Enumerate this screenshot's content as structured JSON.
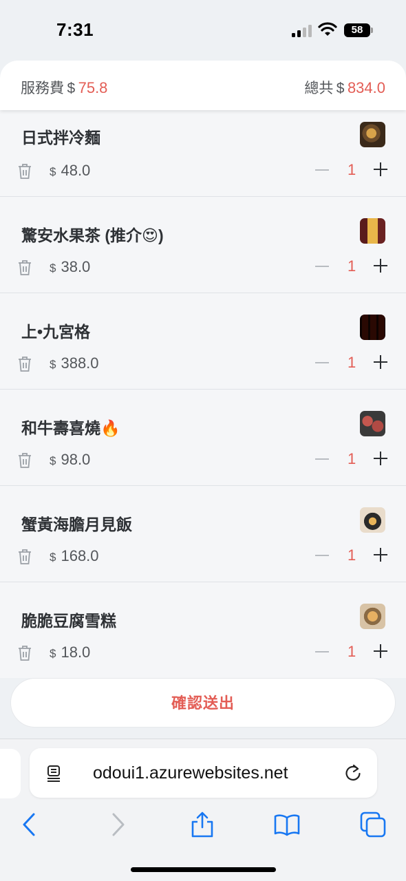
{
  "status_bar": {
    "time": "7:31",
    "battery": "58"
  },
  "summary": {
    "service_label": "服務費",
    "service_currency": "$",
    "service_value": "75.8",
    "total_label": "總共",
    "total_currency": "$",
    "total_value": "834.0"
  },
  "currency": "$",
  "items": [
    {
      "name": "日式拌冷麵",
      "price": "48.0",
      "qty": "1",
      "thumb_icon": "noodle-dish-thumbnail"
    },
    {
      "name": "驚安水果茶 (推介😍)",
      "price": "38.0",
      "qty": "1",
      "thumb_icon": "fruit-tea-thumbnail"
    },
    {
      "name": "上•九宮格",
      "price": "388.0",
      "qty": "1",
      "thumb_icon": "bento-box-thumbnail"
    },
    {
      "name": "和牛壽喜燒🔥",
      "price": "98.0",
      "qty": "1",
      "thumb_icon": "wagyu-thumbnail"
    },
    {
      "name": "蟹黃海膽月見飯",
      "price": "168.0",
      "qty": "1",
      "thumb_icon": "rice-bowl-thumbnail"
    },
    {
      "name": "脆脆豆腐雪糕",
      "price": "18.0",
      "qty": "1",
      "thumb_icon": "tofu-icecream-thumbnail"
    }
  ],
  "confirm_label": "確認送出",
  "browser": {
    "url": "odoui1.azurewebsites.net"
  },
  "colors": {
    "accent": "#e35d55",
    "text": "#2e3135",
    "muted": "#54575b",
    "background": "#eef1f4"
  }
}
